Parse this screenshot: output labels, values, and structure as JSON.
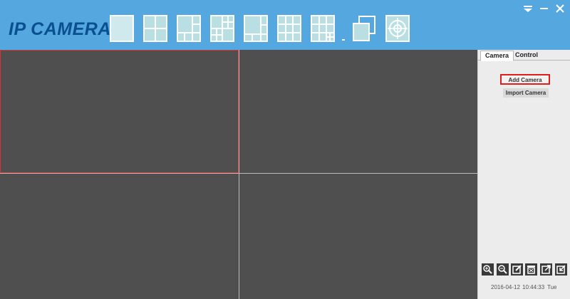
{
  "app": {
    "title": "IP CAMERA"
  },
  "toolbar": {
    "layouts": [
      {
        "name": "layout-1-icon"
      },
      {
        "name": "layout-4-icon"
      },
      {
        "name": "layout-6-icon"
      },
      {
        "name": "layout-8-icon"
      },
      {
        "name": "layout-9-icon"
      },
      {
        "name": "layout-13-icon"
      },
      {
        "name": "layout-16-icon"
      },
      {
        "name": "layout-more-icon"
      }
    ],
    "dropdown_icon": "dropdown-arrow-icon",
    "extra": [
      {
        "name": "fullscreen-icon"
      },
      {
        "name": "cruise-icon"
      }
    ]
  },
  "window": {
    "controls": [
      "menu-icon",
      "minimize-icon",
      "close-icon"
    ]
  },
  "video": {
    "panes": 4,
    "selected": 1
  },
  "sidebar": {
    "tabs": [
      {
        "label": "Camera",
        "active": true
      },
      {
        "label": "Control",
        "active": false
      }
    ],
    "buttons": {
      "add": "Add Camera",
      "import": "Import Camera"
    },
    "tools": [
      "zoom-in-icon",
      "zoom-out-icon",
      "edit-icon",
      "delete-icon",
      "export-icon",
      "import-icon"
    ]
  },
  "status": {
    "date": "2016-04-12",
    "time": "10:44:33",
    "weekday": "Tue"
  },
  "colors": {
    "header": "#55a7df",
    "title": "#0a4f8f",
    "video_bg": "#4f4f4f",
    "selected_border": "#d53535",
    "highlight": "#e21d1d"
  }
}
